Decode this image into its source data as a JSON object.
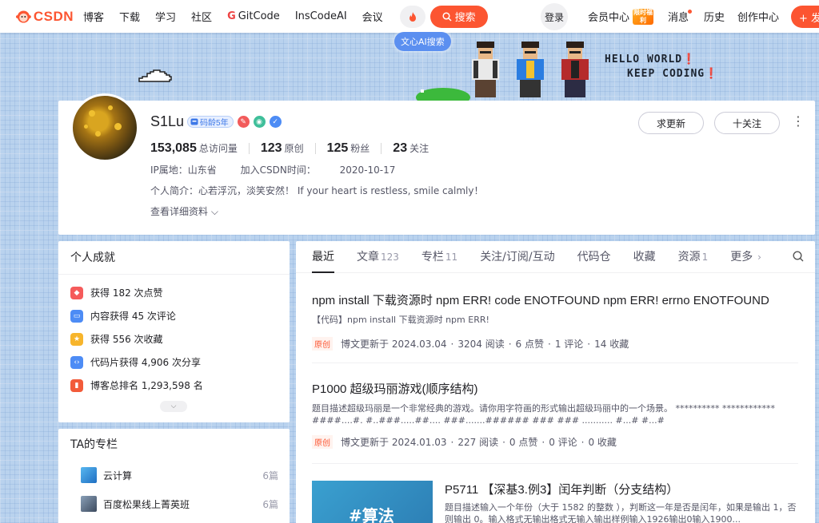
{
  "nav": {
    "logo": "CSDN",
    "items": [
      "博客",
      "下载",
      "学习",
      "社区",
      "GitCode",
      "InsCodeAI",
      "会议"
    ],
    "search_label": "搜索",
    "ai_search": "文心AI搜索",
    "login": "登录",
    "vip": "会员中心",
    "vip_badge": "限时福利",
    "messages": "消息",
    "history": "历史",
    "creator": "创作中心",
    "publish": "+ 发布",
    "accent": "#fc5531"
  },
  "banner": {
    "line1": "HELLO WORLD❗",
    "line2": "KEEP CODING❗"
  },
  "profile": {
    "name": "S1Lu",
    "code_age": "码龄5年",
    "stats": [
      {
        "value": "153,085",
        "label": "总访问量"
      },
      {
        "value": "123",
        "label": "原创"
      },
      {
        "value": "125",
        "label": "粉丝"
      },
      {
        "value": "23",
        "label": "关注"
      }
    ],
    "ip_label": "IP属地：山东省",
    "join_label": "加入CSDN时间：",
    "join_date": "2020-10-17",
    "bio": "个人简介：心若浮沉，淡笑安然！ If your heart is restless, smile calmly！",
    "more": "查看详细资料",
    "request_update": "求更新",
    "follow": "十关注"
  },
  "achievements": {
    "title": "个人成就",
    "items": [
      {
        "icon": "like-icon",
        "text": "获得 182 次点赞",
        "color": "#f55b5b"
      },
      {
        "icon": "comment-icon",
        "text": "内容获得 45 次评论",
        "color": "#4d8cf5"
      },
      {
        "icon": "star-icon",
        "text": "获得 556 次收藏",
        "color": "#f7b52c"
      },
      {
        "icon": "code-icon",
        "text": "代码片获得 4,906 次分享",
        "color": "#4d8cf5"
      },
      {
        "icon": "rank-icon",
        "text": "博客总排名 1,293,598 名",
        "color": "#f25b3a"
      }
    ]
  },
  "columns": {
    "title": "TA的专栏",
    "items": [
      {
        "name": "云计算",
        "count": "6篇",
        "thumb_color": "#2f8fd8"
      },
      {
        "name": "百度松果线上菁英班",
        "count": "6篇",
        "thumb_color": "#5a6f8a"
      }
    ]
  },
  "tabs": [
    {
      "label": "最近",
      "count": ""
    },
    {
      "label": "文章",
      "count": "123"
    },
    {
      "label": "专栏",
      "count": "11"
    },
    {
      "label": "关注/订阅/互动",
      "count": ""
    },
    {
      "label": "代码仓",
      "count": ""
    },
    {
      "label": "收藏",
      "count": ""
    },
    {
      "label": "资源",
      "count": "1"
    },
    {
      "label": "更多",
      "count": ""
    }
  ],
  "articles": [
    {
      "title": "npm install 下载资源时 npm ERR! code ENOTFOUND npm ERR! errno ENOTFOUND",
      "desc": "【代码】npm install 下载资源时 npm ERR!",
      "tag": "原创",
      "updated": "博文更新于 2024.03.04",
      "reads": "3204 阅读",
      "likes": "6 点赞",
      "comments": "1 评论",
      "favs": "14 收藏"
    },
    {
      "title": "P1000 超级玛丽游戏(顺序结构)",
      "desc": "题目描述超级玛丽是一个非常经典的游戏。请你用字符画的形式输出超级玛丽中的一个场景。 ********** ************ ####....#. #..###.....##.... ###.......###### ### ### ........... #...# #...#",
      "tag": "原创",
      "updated": "博文更新于 2024.01.03",
      "reads": "227 阅读",
      "likes": "0 点赞",
      "comments": "0 评论",
      "favs": "0 收藏"
    },
    {
      "title": "P5711 【深基3.例3】闰年判断（分支结构）",
      "desc": "题目描述输入一个年份（大于 1582 的整数 ），判断这一年是否是闰年，如果是输出 1，否则输出 0。输入格式无输出格式无输入输出样例输入1926输出0输入1900...",
      "thumb_text": "#算法"
    }
  ]
}
